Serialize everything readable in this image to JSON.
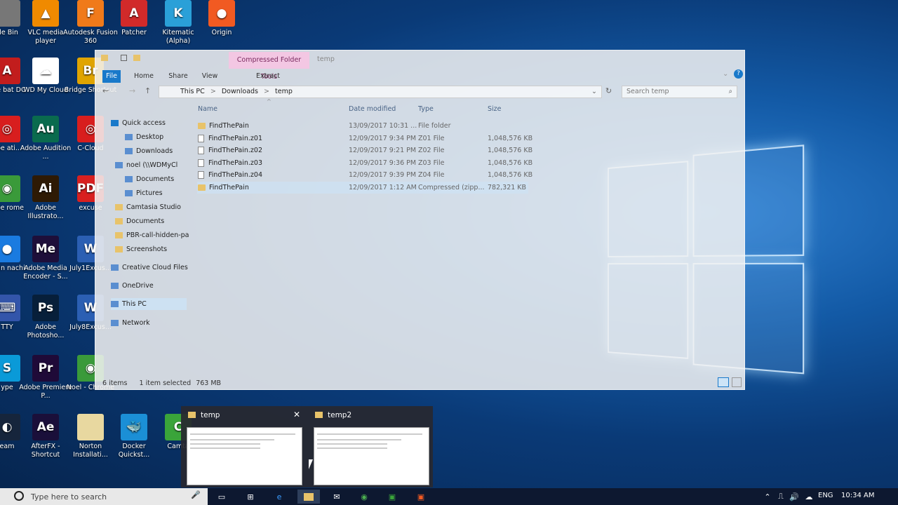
{
  "desktop": {
    "icons": [
      {
        "label": "cle Bin",
        "color": "#777777",
        "glyph": ""
      },
      {
        "label": "VLC media player",
        "color": "#f08a00",
        "glyph": "▲"
      },
      {
        "label": "Autodesk Fusion 360",
        "color": "#f07a1a",
        "glyph": "F"
      },
      {
        "label": "Patcher",
        "color": "#d12a2a",
        "glyph": "A"
      },
      {
        "label": "Kitematic (Alpha)",
        "color": "#2aa0d8",
        "glyph": "K"
      },
      {
        "label": "Origin",
        "color": "#f15a22",
        "glyph": "●"
      },
      {
        "label": "obe bat DC",
        "color": "#c21d1d",
        "glyph": "A"
      },
      {
        "label": "WD My Cloud",
        "color": "#ffffff",
        "glyph": "☁"
      },
      {
        "label": "Bridge Shortcut",
        "color": "#e0a400",
        "glyph": "Br"
      },
      {
        "label": "obe ati...",
        "color": "#d81e1e",
        "glyph": "◎"
      },
      {
        "label": "Adobe Audition ...",
        "color": "#0a6b4e",
        "glyph": "Au"
      },
      {
        "label": "C-Cloud",
        "color": "#d81e1e",
        "glyph": "◎"
      },
      {
        "label": "ogle rome",
        "color": "#3a9a3a",
        "glyph": "◉"
      },
      {
        "label": "Adobe Illustrato...",
        "color": "#2e1a05",
        "glyph": "Ai"
      },
      {
        "label": "excuse",
        "color": "#d82020",
        "glyph": "PDF"
      },
      {
        "label": "Meln nachi",
        "color": "#1a7be0",
        "glyph": "●"
      },
      {
        "label": "Adobe Media Encoder - S...",
        "color": "#1e0f3a",
        "glyph": "Me"
      },
      {
        "label": "July1Excus...",
        "color": "#2b5fb3",
        "glyph": "W"
      },
      {
        "label": "TTY",
        "color": "#3355aa",
        "glyph": "⌨"
      },
      {
        "label": "Adobe Photosho...",
        "color": "#071f3a",
        "glyph": "Ps"
      },
      {
        "label": "July8Excus...",
        "color": "#2b5fb3",
        "glyph": "W"
      },
      {
        "label": "ype",
        "color": "#0a9ad8",
        "glyph": "S"
      },
      {
        "label": "Adobe Premiere P...",
        "color": "#1f0a38",
        "glyph": "Pr"
      },
      {
        "label": "Noel - Chrome",
        "color": "#3a9a3a",
        "glyph": "◉"
      },
      {
        "label": "eam",
        "color": "#16253c",
        "glyph": "◐"
      },
      {
        "label": "AfterFX - Shortcut",
        "color": "#1a0f3a",
        "glyph": "Ae"
      },
      {
        "label": "Norton Installati...",
        "color": "#e8d8a0",
        "glyph": ""
      },
      {
        "label": "Docker Quickst...",
        "color": "#1b8fd6",
        "glyph": "🐳"
      },
      {
        "label": "Camta",
        "color": "#3aa43a",
        "glyph": "C"
      }
    ]
  },
  "window": {
    "ribbon": {
      "context_title": "Compressed Folder Tools",
      "window_title": "temp",
      "tabs": [
        "File",
        "Home",
        "Share",
        "View",
        "Extract"
      ]
    },
    "address": {
      "parts": [
        "This PC",
        ">",
        "Downloads",
        ">",
        "temp"
      ]
    },
    "search": {
      "placeholder": "Search temp"
    },
    "nav": [
      {
        "label": "Quick access",
        "icon": "star-icon"
      },
      {
        "label": "Desktop",
        "icon": "desktop-icon"
      },
      {
        "label": "Downloads",
        "icon": "download-icon"
      },
      {
        "label": "noel (\\\\WDMyCl",
        "icon": "network-drive-icon"
      },
      {
        "label": "Documents",
        "icon": "documents-icon"
      },
      {
        "label": "Pictures",
        "icon": "pictures-icon"
      },
      {
        "label": "Camtasia Studio",
        "icon": "folder-icon"
      },
      {
        "label": "Documents",
        "icon": "folder-icon"
      },
      {
        "label": "PBR-call-hidden-pa",
        "icon": "folder-icon"
      },
      {
        "label": "Screenshots",
        "icon": "folder-icon"
      },
      {
        "label": "Creative Cloud Files",
        "icon": "cloud-icon"
      },
      {
        "label": "OneDrive",
        "icon": "onedrive-icon"
      },
      {
        "label": "This PC",
        "icon": "computer-icon"
      },
      {
        "label": "Network",
        "icon": "network-icon"
      }
    ],
    "columns": [
      "Name",
      "Date modified",
      "Type",
      "Size"
    ],
    "files": [
      {
        "name": "FindThePain",
        "date": "13/09/2017 10:31 ...",
        "type": "File folder",
        "size": "",
        "kind": "folder"
      },
      {
        "name": "FindThePain.z01",
        "date": "12/09/2017 9:34 PM",
        "type": "Z01 File",
        "size": "1,048,576 KB",
        "kind": "file"
      },
      {
        "name": "FindThePain.z02",
        "date": "12/09/2017 9:21 PM",
        "type": "Z02 File",
        "size": "1,048,576 KB",
        "kind": "file"
      },
      {
        "name": "FindThePain.z03",
        "date": "12/09/2017 9:36 PM",
        "type": "Z03 File",
        "size": "1,048,576 KB",
        "kind": "file"
      },
      {
        "name": "FindThePain.z04",
        "date": "12/09/2017 9:39 PM",
        "type": "Z04 File",
        "size": "1,048,576 KB",
        "kind": "file"
      },
      {
        "name": "FindThePain",
        "date": "12/09/2017 1:12 AM",
        "type": "Compressed (zipp...",
        "size": "782,321 KB",
        "kind": "zip"
      }
    ],
    "status": {
      "items": "6 items",
      "selected": "1 item selected",
      "size": "763 MB"
    }
  },
  "thumbnails": [
    {
      "title": "temp"
    },
    {
      "title": "temp2"
    }
  ],
  "taskbar": {
    "search_placeholder": "Type here to search",
    "lang": "ENG",
    "time": "10:34 AM"
  },
  "colors": {
    "accent": "#1979ca",
    "context_tab": "#f3c7e3",
    "taskbar": "#0d1830"
  }
}
